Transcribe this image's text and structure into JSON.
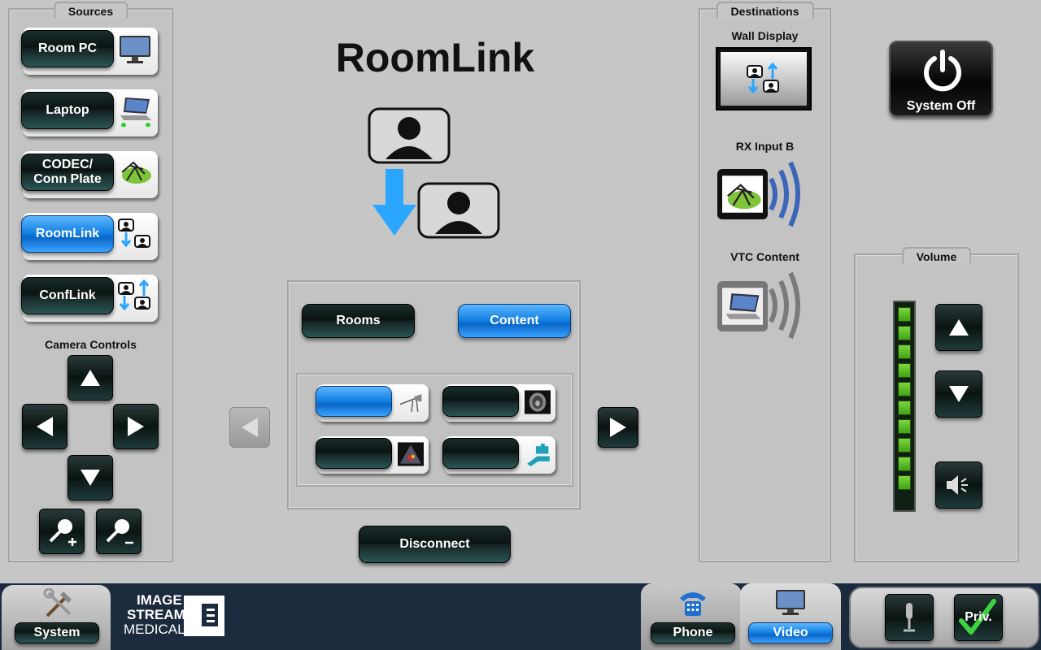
{
  "title": "RoomLink",
  "sources": {
    "label": "Sources",
    "items": [
      {
        "label": "Room PC",
        "icon": "monitor-icon"
      },
      {
        "label": "Laptop",
        "icon": "laptop-icon"
      },
      {
        "label": "CODEC/\nConn Plate",
        "icon": "codec-icon"
      },
      {
        "label": "RoomLink",
        "icon": "roomlink-icon",
        "active": true
      },
      {
        "label": "ConfLink",
        "icon": "conflink-icon"
      }
    ],
    "camera_controls_label": "Camera Controls"
  },
  "destinations": {
    "label": "Destinations",
    "items": [
      {
        "label": "Wall Display"
      },
      {
        "label": "RX Input B"
      },
      {
        "label": "VTC Content"
      }
    ]
  },
  "system_off_label": "System Off",
  "center": {
    "rooms_label": "Rooms",
    "content_label": "Content",
    "disconnect_label": "Disconnect"
  },
  "volume": {
    "label": "Volume",
    "level_segments": 10
  },
  "bottom": {
    "system_label": "System",
    "logo_lines": [
      "IMAGE",
      "STREAM",
      "MEDICAL"
    ],
    "phone_label": "Phone",
    "video_label": "Video",
    "privacy_label": "Priv."
  },
  "colors": {
    "accent_blue": "#1e8cf0",
    "arrow_blue": "#2aa6ff",
    "active_green": "#3fd23f"
  }
}
